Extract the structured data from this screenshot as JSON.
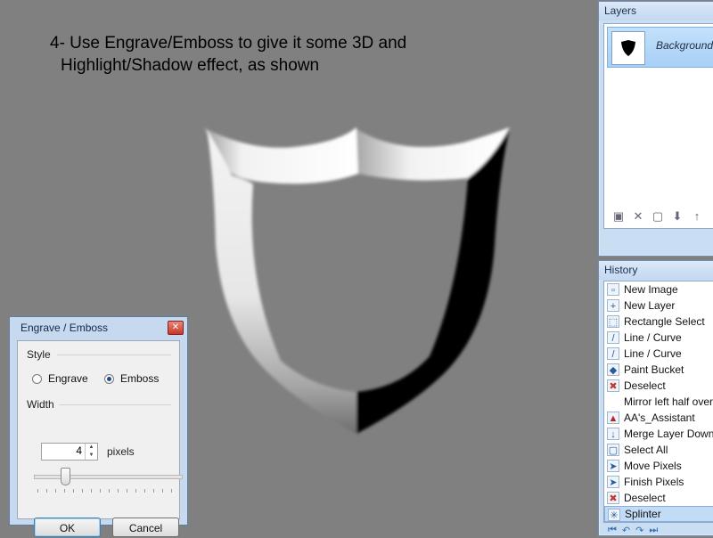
{
  "instruction": {
    "line1": "4- Use Engrave/Emboss to give it some 3D and",
    "line2": "Highlight/Shadow effect, as shown"
  },
  "layers": {
    "title": "Layers",
    "items": [
      {
        "label": "Background"
      }
    ],
    "toolbar_icons": [
      "add-layer-icon",
      "delete-layer-icon",
      "duplicate-layer-icon",
      "merge-layer-down-icon",
      "move-layer-up-icon",
      "move-layer-down-icon"
    ]
  },
  "history": {
    "title": "History",
    "items": [
      {
        "label": "New Image",
        "icon": "new-image-icon"
      },
      {
        "label": "New Layer",
        "icon": "new-layer-icon"
      },
      {
        "label": "Rectangle Select",
        "icon": "rectangle-select-icon"
      },
      {
        "label": "Line / Curve",
        "icon": "line-curve-icon"
      },
      {
        "label": "Line / Curve",
        "icon": "line-curve-icon"
      },
      {
        "label": "Paint Bucket",
        "icon": "paint-bucket-icon"
      },
      {
        "label": "Deselect",
        "icon": "deselect-icon"
      },
      {
        "label": "Mirror left half over rig",
        "icon": ""
      },
      {
        "label": "AA's_Assistant",
        "icon": "effect-icon"
      },
      {
        "label": "Merge Layer Down",
        "icon": "merge-layer-down-icon"
      },
      {
        "label": "Select All",
        "icon": "select-all-icon"
      },
      {
        "label": "Move Pixels",
        "icon": "move-pixels-icon"
      },
      {
        "label": "Finish Pixels",
        "icon": "finish-pixels-icon"
      },
      {
        "label": "Deselect",
        "icon": "deselect-icon"
      },
      {
        "label": "Splinter",
        "icon": "splinter-icon",
        "selected": true
      }
    ],
    "nav_icons": [
      "rewind-icon",
      "undo-icon",
      "redo-icon",
      "fast-forward-icon"
    ]
  },
  "dialog": {
    "title": "Engrave / Emboss",
    "close_glyph": "✕",
    "style_label": "Style",
    "engrave_label": "Engrave",
    "emboss_label": "Emboss",
    "selected_style": "Emboss",
    "width_label": "Width",
    "width_value": "4",
    "width_unit": "pixels",
    "ok_label": "OK",
    "cancel_label": "Cancel"
  },
  "colors": {
    "canvas": "#808080",
    "window_frame": "#c9ddf3",
    "selection": "#c3dcf6"
  }
}
